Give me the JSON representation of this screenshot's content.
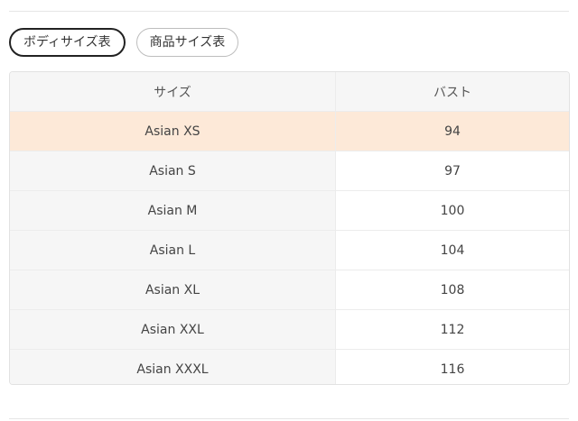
{
  "tabs": [
    {
      "label": "ボディサイズ表",
      "active": true
    },
    {
      "label": "商品サイズ表",
      "active": false
    }
  ],
  "table": {
    "headers": [
      "サイズ",
      "バスト"
    ],
    "rows": [
      {
        "size": "Asian XS",
        "bust": "94",
        "highlighted": true
      },
      {
        "size": "Asian S",
        "bust": "97",
        "highlighted": false
      },
      {
        "size": "Asian M",
        "bust": "100",
        "highlighted": false
      },
      {
        "size": "Asian L",
        "bust": "104",
        "highlighted": false
      },
      {
        "size": "Asian XL",
        "bust": "108",
        "highlighted": false
      },
      {
        "size": "Asian XXL",
        "bust": "112",
        "highlighted": false
      },
      {
        "size": "Asian XXXL",
        "bust": "116",
        "highlighted": false
      }
    ]
  },
  "colors": {
    "highlight_row": "#fde9d8",
    "header_bg": "#f6f6f6",
    "active_tab_border": "#222222"
  }
}
